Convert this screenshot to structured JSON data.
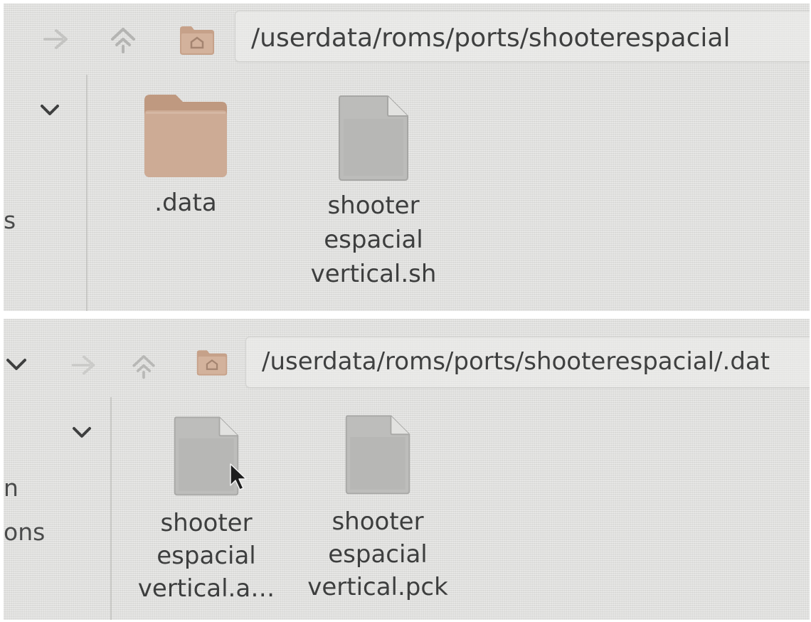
{
  "screen1": {
    "path": "/userdata/roms/ports/shooterespacial",
    "sidebar_fragments": [
      "s"
    ],
    "files": [
      {
        "type": "folder",
        "lines": [
          ".data"
        ]
      },
      {
        "type": "file",
        "lines": [
          "shooter",
          "espacial",
          "vertical.sh"
        ]
      }
    ],
    "icons": [
      "forward-arrow-icon",
      "go-up-icon",
      "home-folder-icon",
      "chevron-down-icon"
    ]
  },
  "screen2": {
    "path": "/userdata/roms/ports/shooterespacial/.dat",
    "sidebar_fragments": [
      "n",
      "ons"
    ],
    "files": [
      {
        "type": "file",
        "lines": [
          "shooter",
          "espacial",
          "vertical.a…"
        ]
      },
      {
        "type": "file",
        "lines": [
          "shooter",
          "espacial",
          "vertical.pck"
        ]
      }
    ],
    "icons": [
      "chevron-down-icon",
      "forward-arrow-icon",
      "go-up-icon",
      "home-folder-icon",
      "mouse-cursor-icon"
    ]
  },
  "colors": {
    "background": "#e3e3e1",
    "folder": "#c9a48b",
    "file_icon": "#bdbdbb",
    "text": "#3f4040"
  }
}
